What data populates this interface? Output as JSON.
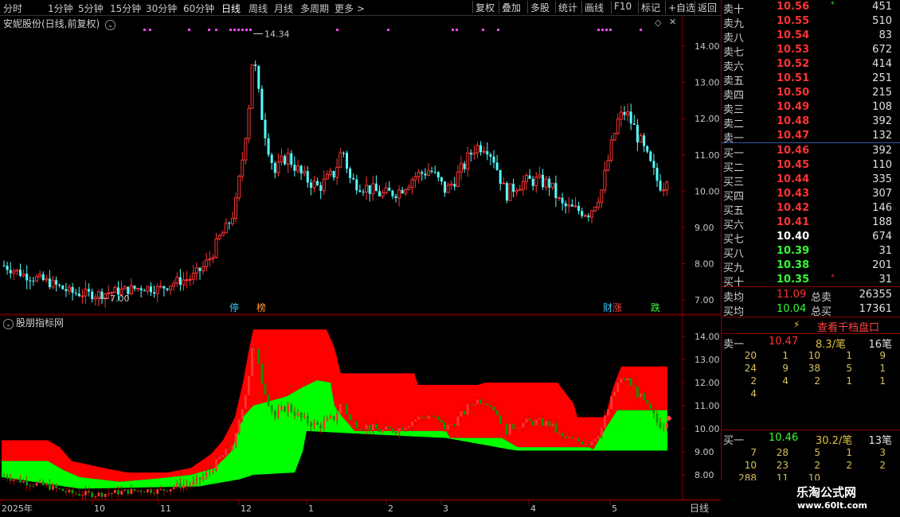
{
  "toolbar": {
    "periods": [
      "分时",
      "1分钟",
      "5分钟",
      "15分钟",
      "30分钟",
      "60分钟",
      "日线",
      "周线",
      "月线",
      "多周期",
      "更多 >"
    ],
    "active_period": "日线",
    "actions": [
      "复权",
      "叠加",
      "多股",
      "统计",
      "画线",
      "F10",
      "标记",
      "+自选",
      "返回"
    ]
  },
  "main_chart": {
    "title": "安妮股份(日线,前复权)",
    "high_label": "14.34",
    "low_label": "7.00",
    "y_ticks": [
      "14.00",
      "13.00",
      "12.00",
      "11.00",
      "10.00",
      "9.00",
      "8.00",
      "7.00"
    ],
    "events": [
      {
        "label": "停",
        "color": "#33ccff"
      },
      {
        "label": "榜",
        "color": "#ff9933"
      },
      {
        "label": "财",
        "color": "#33ccff"
      },
      {
        "label": "涨",
        "color": "#ff4444"
      },
      {
        "label": "跌",
        "color": "#33ff33"
      }
    ]
  },
  "indicator_chart": {
    "title": "股朋指标网",
    "y_ticks": [
      "14.00",
      "13.00",
      "12.00",
      "11.00",
      "10.00",
      "9.00",
      "8.00"
    ]
  },
  "x_axis": {
    "labels": [
      "2025年",
      "10",
      "11",
      "12",
      "1",
      "2",
      "3",
      "4",
      "5"
    ],
    "period_label": "日线"
  },
  "order_book": {
    "asks": [
      {
        "label": "卖十",
        "price": "10.56",
        "vol": "451",
        "mark": "*"
      },
      {
        "label": "卖九",
        "price": "10.55",
        "vol": "510"
      },
      {
        "label": "卖八",
        "price": "10.54",
        "vol": "83"
      },
      {
        "label": "卖七",
        "price": "10.53",
        "vol": "672"
      },
      {
        "label": "卖六",
        "price": "10.52",
        "vol": "414"
      },
      {
        "label": "卖五",
        "price": "10.51",
        "vol": "251"
      },
      {
        "label": "卖四",
        "price": "10.50",
        "vol": "215"
      },
      {
        "label": "卖三",
        "price": "10.49",
        "vol": "108"
      },
      {
        "label": "卖二",
        "price": "10.48",
        "vol": "392"
      },
      {
        "label": "卖一",
        "price": "10.47",
        "vol": "132"
      }
    ],
    "bids": [
      {
        "label": "买一",
        "price": "10.46",
        "vol": "392"
      },
      {
        "label": "买二",
        "price": "10.45",
        "vol": "110"
      },
      {
        "label": "买三",
        "price": "10.44",
        "vol": "335"
      },
      {
        "label": "买四",
        "price": "10.43",
        "vol": "307"
      },
      {
        "label": "买五",
        "price": "10.42",
        "vol": "146"
      },
      {
        "label": "买六",
        "price": "10.41",
        "vol": "188"
      },
      {
        "label": "买七",
        "price": "10.40",
        "vol": "674"
      },
      {
        "label": "买八",
        "price": "10.39",
        "vol": "31"
      },
      {
        "label": "买九",
        "price": "10.38",
        "vol": "201"
      },
      {
        "label": "买十",
        "price": "10.35",
        "vol": "31",
        "mark": "*"
      }
    ],
    "avg_sell_label": "卖均",
    "avg_sell": "11.09",
    "total_sell_label": "总卖",
    "total_sell": "26355",
    "avg_buy_label": "买均",
    "avg_buy": "10.04",
    "total_buy_label": "总买",
    "total_buy": "17361"
  },
  "thousand_level": {
    "button": "查看千档盘口",
    "sell_label": "卖一",
    "sell_price": "10.47",
    "sell_per": "8.3/笔",
    "sell_count": "16笔",
    "sell_rows": [
      [
        "20",
        "1",
        "10",
        "1",
        "9"
      ],
      [
        "24",
        "9",
        "38",
        "5",
        "1"
      ],
      [
        "2",
        "4",
        "2",
        "1",
        "1"
      ],
      [
        "4",
        "",
        "",
        "",
        ""
      ]
    ],
    "buy_label": "买一",
    "buy_price": "10.46",
    "buy_per": "30.2/笔",
    "buy_count": "13笔",
    "buy_rows": [
      [
        "7",
        "28",
        "5",
        "1",
        "3"
      ],
      [
        "10",
        "23",
        "2",
        "2",
        "2"
      ],
      [
        "288",
        "11",
        "10",
        "",
        ""
      ]
    ]
  },
  "watermark": {
    "title": "乐淘公式网",
    "url": "www.60lt.com"
  },
  "colors": {
    "up": "#ff3333",
    "down": "#54ffff",
    "ma_fill": "#00ff00",
    "band_fill": "#ff0000",
    "grid": "#8b0000"
  }
}
